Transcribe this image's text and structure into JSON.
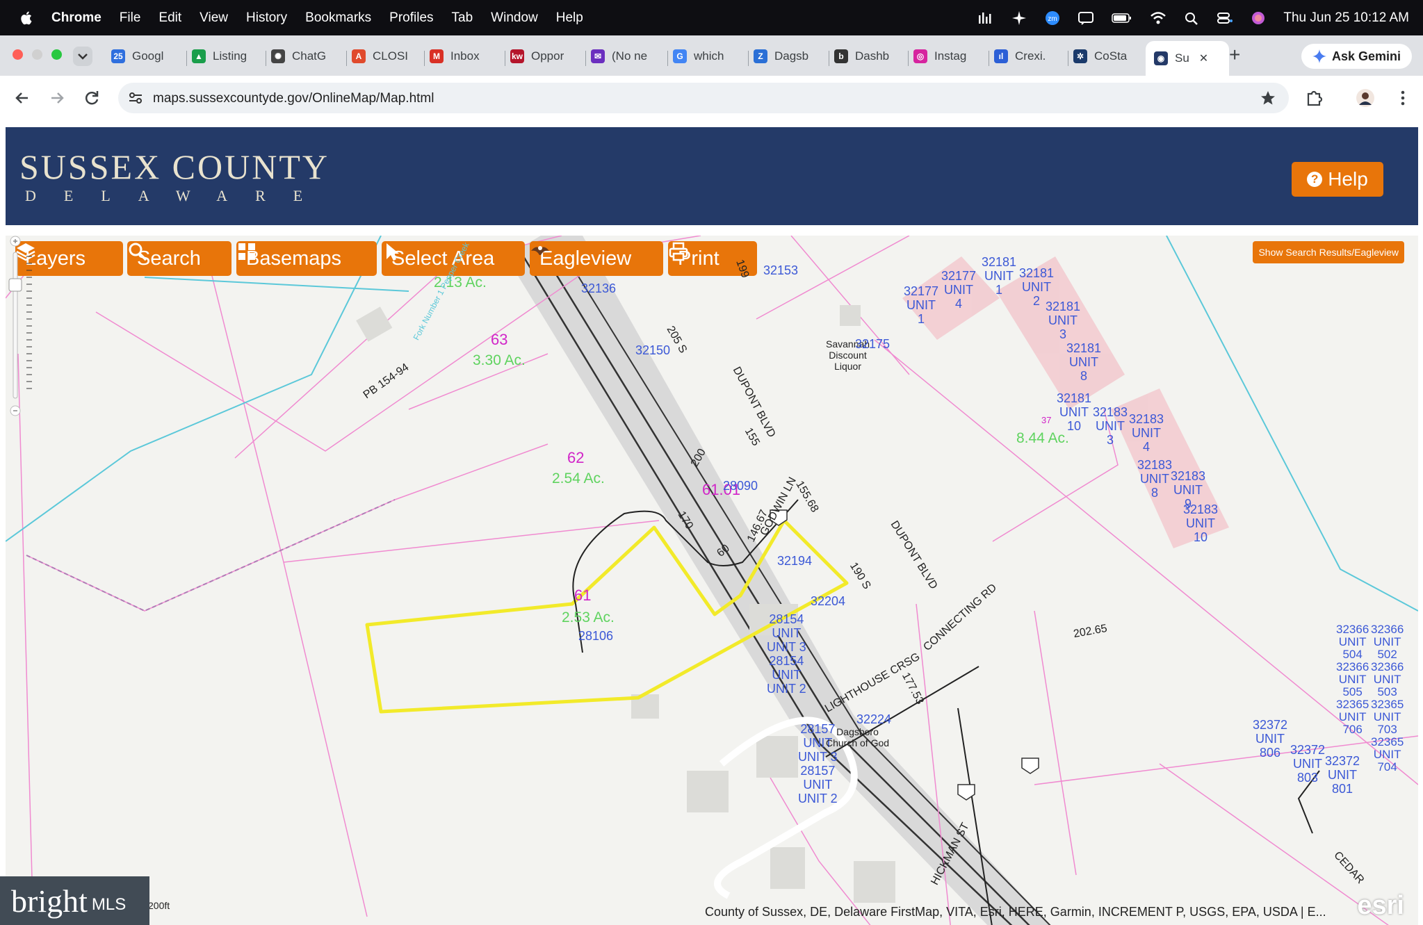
{
  "menubar": {
    "items": [
      "Chrome",
      "File",
      "Edit",
      "View",
      "History",
      "Bookmarks",
      "Profiles",
      "Tab",
      "Window",
      "Help"
    ],
    "datetime": "Thu Jun 25  10:12 AM"
  },
  "tabs": [
    {
      "label": "Googl",
      "fav": "25",
      "color": "#2f6fde"
    },
    {
      "label": "Listing",
      "fav": "▲",
      "color": "#1a9e4b"
    },
    {
      "label": "ChatG",
      "fav": "✺",
      "color": "#444"
    },
    {
      "label": "CLOSI",
      "fav": "A",
      "color": "#e04a2c"
    },
    {
      "label": "Inbox",
      "fav": "M",
      "color": "#d93025"
    },
    {
      "label": "Oppor",
      "fav": "kw",
      "color": "#b5152b"
    },
    {
      "label": "(No ne",
      "fav": "✉",
      "color": "#6b2fbf"
    },
    {
      "label": "which",
      "fav": "G",
      "color": "#4285f4"
    },
    {
      "label": "Dagsb",
      "fav": "Z",
      "color": "#2a6fd6"
    },
    {
      "label": "Dashb",
      "fav": "b",
      "color": "#333"
    },
    {
      "label": "Instag",
      "fav": "◎",
      "color": "#d6249f"
    },
    {
      "label": "Crexi.",
      "fav": "ıl",
      "color": "#2c5fd6"
    },
    {
      "label": "CoSta",
      "fav": "✲",
      "color": "#1b3a6b"
    },
    {
      "label": "Su",
      "fav": "◉",
      "color": "#243a68"
    }
  ],
  "gemini_label": "Ask Gemini",
  "url": "maps.sussexcountyde.gov/OnlineMap/Map.html",
  "banner": {
    "title": "SUSSEX COUNTY",
    "subtitle": "DELAWARE",
    "help": "Help"
  },
  "map_buttons": {
    "layers": "Layers",
    "search": "Search",
    "basemaps": "Basemaps",
    "select": "Select Area",
    "eagleview": "Eagleview",
    "print": "Print"
  },
  "show_results": "Show Search Results/Eagleview",
  "labels": {
    "l32153": "32153",
    "l32136": "32136",
    "l32150": "32150",
    "l63": "63",
    "l63ac": "3.30 Ac.",
    "l213": "2.13 Ac.",
    "l62": "62",
    "l62ac": "2.54 Ac.",
    "l6101": "61.01",
    "l28090": "28090",
    "l32194": "32194",
    "l61": "61",
    "l61ac": "2.53 Ac.",
    "l28106": "28106",
    "l32204": "32204",
    "l28154": "28154\nUNIT\nUNIT 3\n28154\nUNIT\nUNIT 2",
    "l32224": "32224",
    "l28157": "28157\nUNIT\nUNIT 3\n28157\nUNIT\nUNIT 2",
    "dagsboro": "Dagsboro\nChurch of God",
    "savannah": "Savannah\nDiscount\nLiquor",
    "l32175": "32175",
    "l32181u1": "32181\nUNIT\n1",
    "l32181u2": "32181\nUNIT\n2",
    "l32177u4": "32177\nUNIT\n4",
    "l32177u1": "32177\nUNIT\n1",
    "l32181u3": "32181\nUNIT\n3",
    "l32181u8": "32181\nUNIT\n8",
    "l32181u10": "32181\nUNIT\n10",
    "l32183u3": "32183\nUNIT\n3",
    "l32183u4": "32183\nUNIT\n4",
    "l32183u8": "32183\nUNIT\n8",
    "l32183u9": "32183\nUNIT\n9",
    "l32183u10": "32183\nUNIT\n10",
    "l844": "8.44 Ac.",
    "l37": "37",
    "l32366": "32366\nUNIT\n504\n32366\nUNIT\n505\n32365\nUNIT\n706",
    "l32366b": "32366\nUNIT\n502\n32366\nUNIT\n503\n32365\nUNIT\n703\n32365\nUNIT\n704",
    "l32372a": "32372\nUNIT\n806",
    "l32372b": "32372\nUNIT\n803",
    "l32372c": "32372\nUNIT\n801",
    "dupont1": "DUPONT BLVD",
    "dupont2": "DUPONT BLVD",
    "pb": "PB 154-94",
    "godwin": "GODWIN LN",
    "lighthouse": "LIGHTHOUSE CRSG",
    "connecting": "CONNECTING RD",
    "hickman": "HICKMAN ST",
    "cedar": "CEDAR",
    "r200": "200",
    "r155": "155",
    "r205": "205 S",
    "r170": "170",
    "r60": "60",
    "r14667": "146.67",
    "r15568": "155.68",
    "r190": "190 S",
    "r17753": "177.53",
    "r20265": "202.65",
    "r199": "199",
    "fork": "Fork Number 1 Pepper Creek"
  },
  "scale": "200ft",
  "attribution": "County of Sussex, DE, Delaware FirstMap, VITA, Esri, HERE, Garmin, INCREMENT P, USGS, EPA, USDA | E...",
  "esri": "esri",
  "bright": {
    "brand": "bright",
    "suffix": "MLS"
  }
}
